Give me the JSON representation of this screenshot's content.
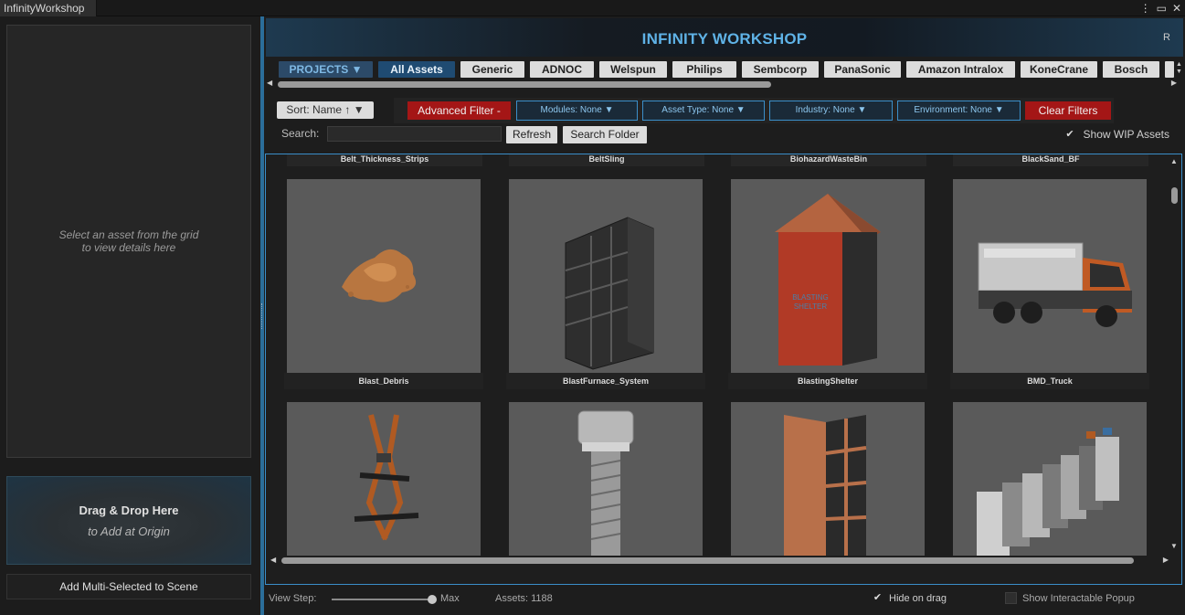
{
  "window": {
    "tab_title": "InfinityWorkshop",
    "controls": [
      "⋮",
      "▭",
      "✕"
    ]
  },
  "left_panel": {
    "details_placeholder_line1": "Select an asset from the grid",
    "details_placeholder_line2": "to view details here",
    "drop_title": "Drag & Drop Here",
    "drop_subtitle": "to Add at Origin",
    "add_multi_label": "Add Multi-Selected to Scene"
  },
  "header": {
    "title": "INFINITY WORKSHOP",
    "corner": "R"
  },
  "project_tabs": {
    "projects_label": "PROJECTS ▼",
    "items": [
      "All Assets",
      "Generic",
      "ADNOC",
      "Welspun",
      "Philips",
      "Sembcorp",
      "PanaSonic",
      "Amazon Intralox",
      "KoneCrane",
      "Bosch"
    ],
    "active": "All Assets"
  },
  "toolbar": {
    "sort_label": "Sort: Name ↑ ▼",
    "advanced_filter_label": "Advanced Filter -",
    "modules_label": "Modules: None ▼",
    "asset_type_label": "Asset Type: None ▼",
    "industry_label": "Industry: None ▼",
    "environment_label": "Environment: None ▼",
    "clear_filters_label": "Clear Filters",
    "search_label": "Search:",
    "search_value": "",
    "refresh_label": "Refresh",
    "search_folder_label": "Search Folder",
    "show_wip_label": "Show WIP Assets",
    "show_wip_checked": true
  },
  "grid": {
    "header_labels": [
      "Belt_Thickness_Strips",
      "BeltSling",
      "BiohazardWasteBin",
      "BlackSand_BF"
    ],
    "row1": [
      "Blast_Debris",
      "BlastFurnace_System",
      "BlastingShelter",
      "BMD_Truck"
    ],
    "row2_thumbnail_icons": [
      "safety-harness-thumbnail",
      "bolt-thumbnail",
      "shelf-cabinet-thumbnail",
      "cable-trays-thumbnail"
    ]
  },
  "footer": {
    "view_step_label": "View Step:",
    "view_step_value": "Max",
    "assets_label": "Assets: 1188",
    "hide_on_drag_label": "Hide on drag",
    "hide_on_drag_checked": true,
    "show_popup_label": "Show Interactable Popup",
    "show_popup_checked": false
  },
  "colors": {
    "accent_blue": "#3a8ec9",
    "title_blue": "#5fb2e6",
    "danger_red": "#a41616",
    "thumbnail_bg": "#5a5a5a"
  }
}
